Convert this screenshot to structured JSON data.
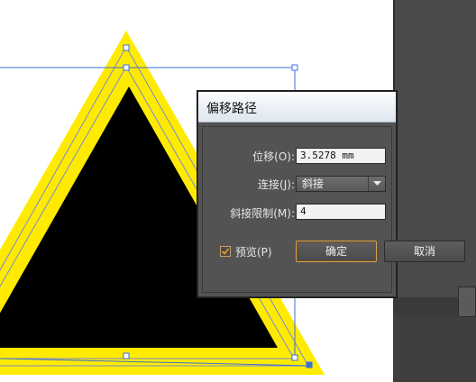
{
  "dialog": {
    "title": "偏移路径",
    "offset": {
      "label": "位移(O):",
      "value": "3.5278 mm"
    },
    "join": {
      "label": "连接(J):",
      "selected": "斜接"
    },
    "miter_limit": {
      "label": "斜接限制(M):",
      "value": "4"
    },
    "preview": {
      "label": "预览(P)",
      "checked": true
    },
    "ok_label": "确定",
    "cancel_label": "取消"
  },
  "colors": {
    "artwork_fill": "#000000",
    "artwork_stroke": "#ffeb00",
    "selection": "#3a6fd8",
    "checkbox_accent": "#f0a030"
  }
}
